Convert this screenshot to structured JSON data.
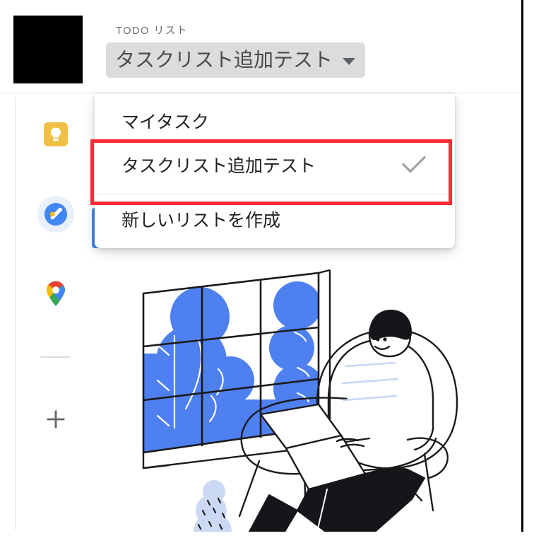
{
  "app": {
    "name": "Google Tasks side panel",
    "accent_blue": "#4285f4",
    "chip_bg": "#dcdcdc",
    "menu_bg": "#ffffff",
    "annotation_color": "#fb2c36"
  },
  "header": {
    "eyebrow": "TODO リスト",
    "selected_list": "タスクリスト追加テスト",
    "caret_icon": "chevron-down-icon",
    "close_icon": "close-icon",
    "overflow_icon": "more-vert-icon"
  },
  "rail": {
    "items": [
      {
        "name": "keep",
        "label": "Google Keep",
        "icon": "keep-lightbulb-icon",
        "active": false
      },
      {
        "name": "tasks",
        "label": "Google Tasks",
        "icon": "tasks-check-icon",
        "active": true
      },
      {
        "name": "maps",
        "label": "Google Maps",
        "icon": "maps-pin-icon",
        "active": false
      }
    ],
    "add_icon": "plus-icon",
    "add_label": "アプリを追加"
  },
  "list_menu": {
    "items": [
      {
        "label": "マイタスク",
        "checked": false
      },
      {
        "label": "タスクリスト追加テスト",
        "checked": true
      }
    ],
    "create_item": {
      "label": "新しいリストを作成",
      "checked": false
    },
    "check_icon": "check-icon"
  },
  "tasks_pane": {
    "add_task_button_label": "",
    "empty_illustration": "person-sitting-with-laptop-by-window"
  }
}
